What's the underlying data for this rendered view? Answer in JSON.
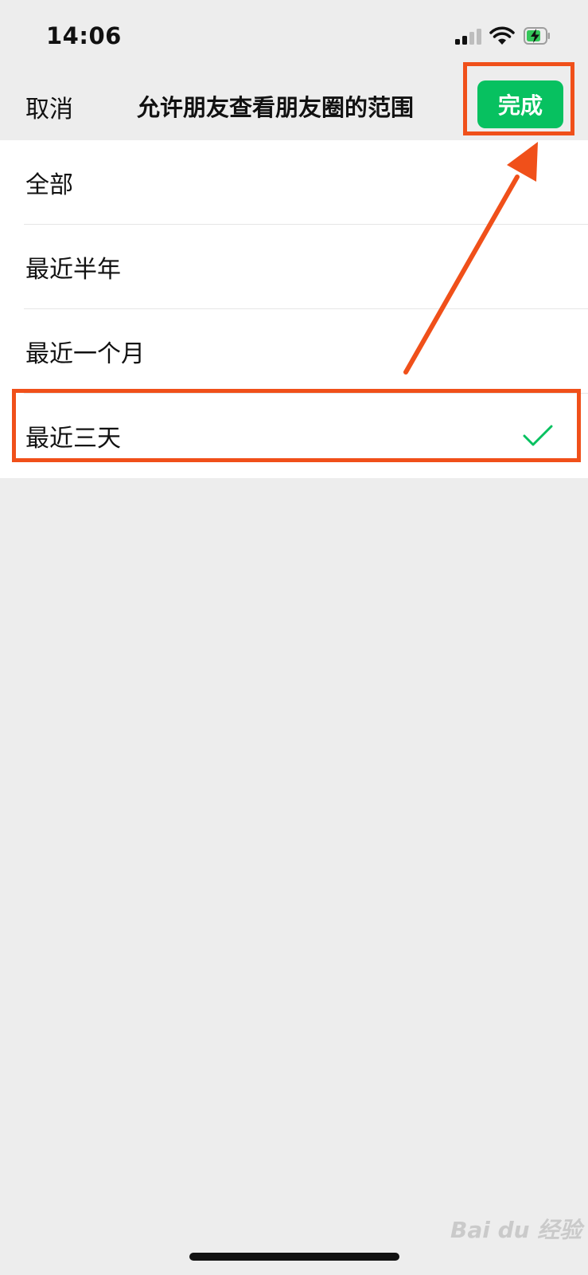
{
  "status_bar": {
    "time": "14:06"
  },
  "nav": {
    "cancel_label": "取消",
    "title": "允许朋友查看朋友圈的范围",
    "done_label": "完成"
  },
  "options": [
    {
      "label": "全部",
      "selected": false
    },
    {
      "label": "最近半年",
      "selected": false
    },
    {
      "label": "最近一个月",
      "selected": false
    },
    {
      "label": "最近三天",
      "selected": true
    }
  ],
  "watermark": "Bai du 经验",
  "colors": {
    "accent_green": "#07c160",
    "annotation_orange": "#f0501a",
    "background": "#ededed"
  }
}
